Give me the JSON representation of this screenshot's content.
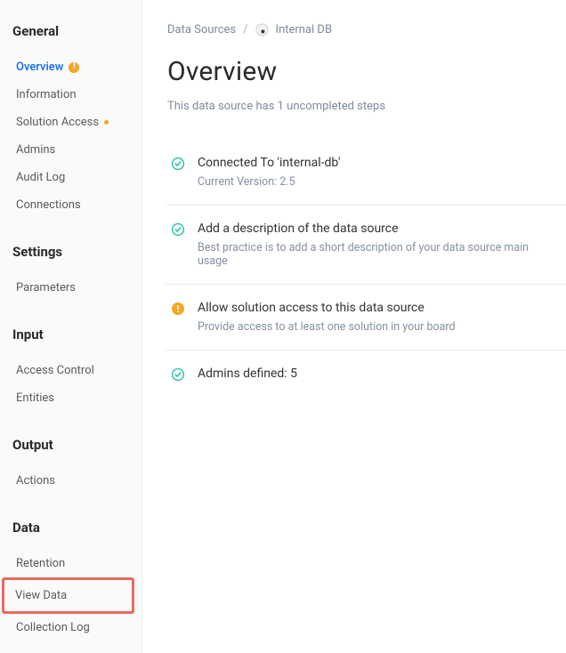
{
  "sidebar": {
    "sections": [
      {
        "title": "General",
        "items": [
          {
            "label": "Overview",
            "active": true,
            "badge": "warn"
          },
          {
            "label": "Information"
          },
          {
            "label": "Solution Access",
            "badge": "dot"
          },
          {
            "label": "Admins"
          },
          {
            "label": "Audit Log"
          },
          {
            "label": "Connections"
          }
        ]
      },
      {
        "title": "Settings",
        "items": [
          {
            "label": "Parameters"
          }
        ]
      },
      {
        "title": "Input",
        "items": [
          {
            "label": "Access Control"
          },
          {
            "label": "Entities"
          }
        ]
      },
      {
        "title": "Output",
        "items": [
          {
            "label": "Actions"
          }
        ]
      },
      {
        "title": "Data",
        "items": [
          {
            "label": "Retention"
          },
          {
            "label": "View Data",
            "highlighted": true
          },
          {
            "label": "Collection Log"
          }
        ]
      }
    ]
  },
  "breadcrumb": {
    "root": "Data Sources",
    "sep": "/",
    "current": "Internal DB"
  },
  "page_title": "Overview",
  "subtitle": "This data source has 1 uncompleted steps",
  "steps": [
    {
      "status": "done",
      "title": "Connected To 'internal-db'",
      "sub": "Current Version: 2.5"
    },
    {
      "status": "done",
      "title": "Add a description of the data source",
      "sub": "Best practice is to add a short description of your data source main usage"
    },
    {
      "status": "warn",
      "title": "Allow solution access to this data source",
      "sub": "Provide access to at least one solution in your board"
    },
    {
      "status": "done",
      "title": "Admins defined: 5",
      "sub": ""
    }
  ],
  "icons": {
    "warn_glyph": "!",
    "check_color": "#22c3a6",
    "warn_color": "#f5a623"
  }
}
